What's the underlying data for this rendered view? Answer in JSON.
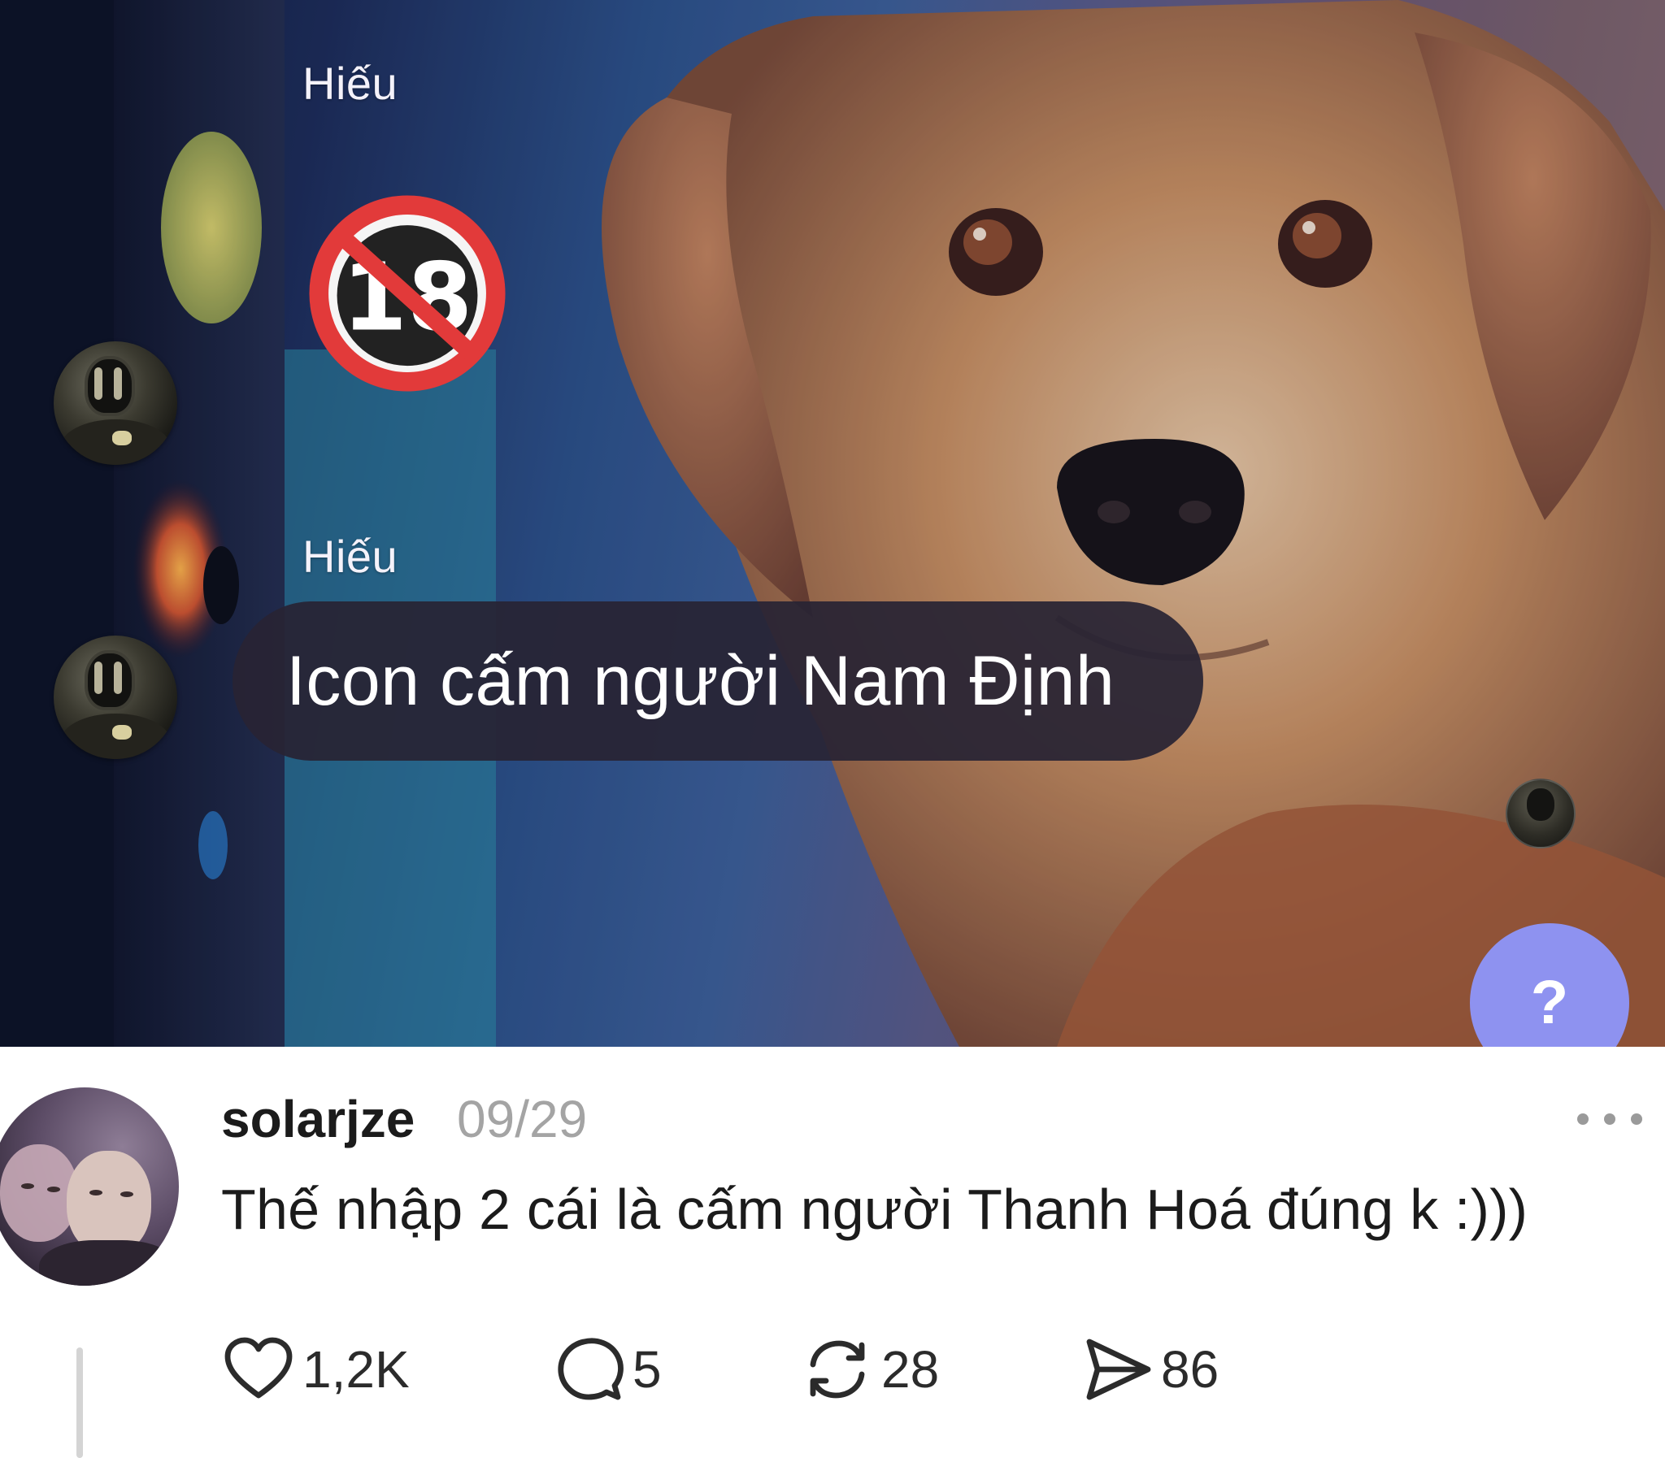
{
  "chat": {
    "messages": [
      {
        "sender": "Hiếu",
        "content_type": "emoji",
        "emoji": "no-one-under-eighteen-icon"
      },
      {
        "sender": "Hiếu",
        "content_type": "text",
        "text": "Icon cấm người Nam Định"
      }
    ],
    "help_button_label": "?",
    "colors": {
      "bubble": "#28243a",
      "help_button": "#8e92f0"
    }
  },
  "post": {
    "username": "solarjze",
    "date": "09/29",
    "text": "Thế nhập 2 cái là cấm người Thanh Hoá đúng k :)))",
    "more_icon": "more-dots-icon",
    "actions": [
      {
        "icon": "heart-icon",
        "count": "1,2K"
      },
      {
        "icon": "comment-icon",
        "count": "5"
      },
      {
        "icon": "repost-icon",
        "count": "28"
      },
      {
        "icon": "send-icon",
        "count": "86"
      }
    ]
  }
}
